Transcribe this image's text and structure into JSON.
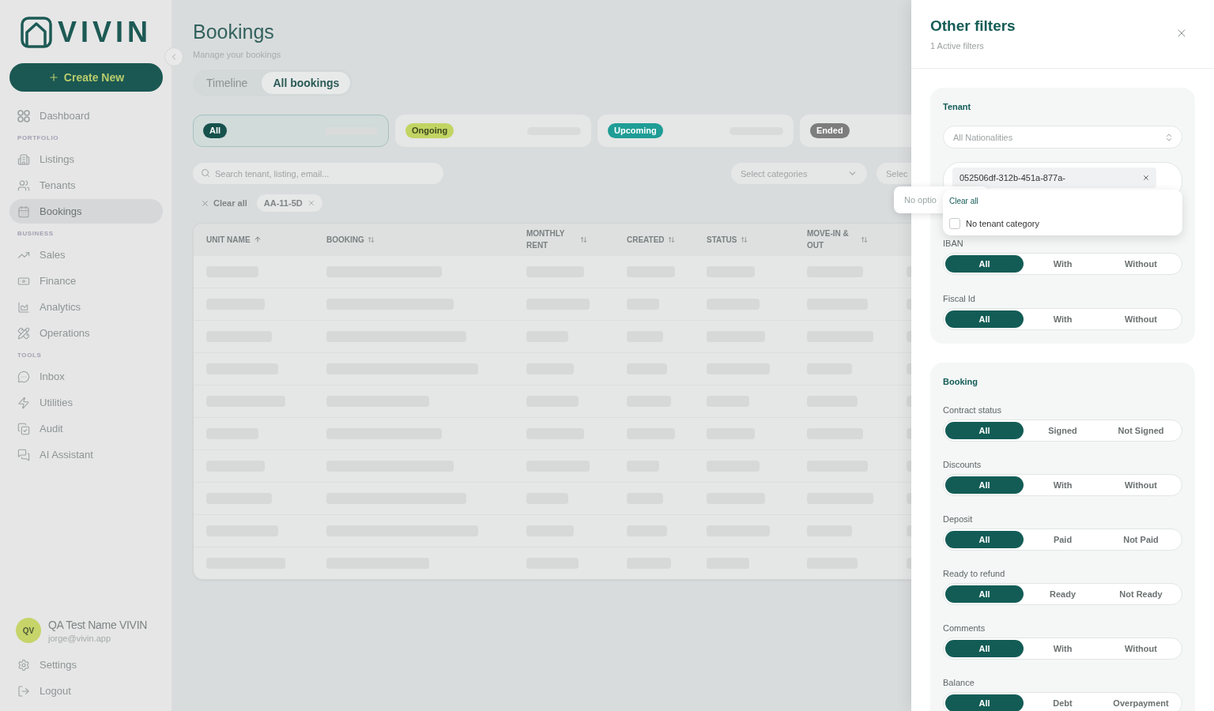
{
  "sidebar": {
    "logo": "VIVIN",
    "create_button": "Create New",
    "nav_groups": [
      {
        "items": [
          {
            "label": "Dashboard",
            "selected": false
          }
        ]
      },
      {
        "heading": "PORTFOLIO",
        "items": [
          {
            "label": "Listings",
            "selected": false
          },
          {
            "label": "Tenants",
            "selected": false
          },
          {
            "label": "Bookings",
            "selected": true
          }
        ]
      },
      {
        "heading": "BUSINESS",
        "items": [
          {
            "label": "Sales",
            "selected": false
          },
          {
            "label": "Finance",
            "selected": false
          },
          {
            "label": "Analytics",
            "selected": false
          },
          {
            "label": "Operations",
            "selected": false
          }
        ]
      },
      {
        "heading": "TOOLS",
        "items": [
          {
            "label": "Inbox",
            "selected": false
          },
          {
            "label": "Utilities",
            "selected": false
          },
          {
            "label": "Audit",
            "selected": false
          },
          {
            "label": "AI Assistant",
            "selected": false
          }
        ]
      }
    ],
    "user": {
      "initials": "QV",
      "name": "QA Test Name VIVIN",
      "email": "jorge@vivin.app"
    },
    "footer_items": [
      "Settings",
      "Logout"
    ]
  },
  "page": {
    "title": "Bookings",
    "subtitle": "Manage your bookings",
    "view_tabs": [
      {
        "label": "Timeline",
        "selected": false
      },
      {
        "label": "All bookings",
        "selected": true
      }
    ],
    "status_cards": {
      "loading": true,
      "items": [
        {
          "label": "All",
          "selected": true,
          "color": "#17514d"
        },
        {
          "label": "Ongoing",
          "selected": false,
          "color": "#c2d463"
        },
        {
          "label": "Upcoming",
          "selected": false,
          "color": "#1f9d96"
        },
        {
          "label": "Ended",
          "selected": false,
          "color": "#7d7d7d"
        }
      ]
    },
    "search": {
      "placeholder": "Search tenant, listing, email..."
    },
    "selects": [
      {
        "placeholder": "Select categories"
      },
      {
        "placeholder": "Selec"
      }
    ],
    "select_popup": {
      "text": "No optio"
    },
    "active_filters": {
      "clear_label": "Clear all",
      "chips": [
        "AA-11-5D"
      ]
    },
    "table": {
      "columns": [
        {
          "label": "UNIT NAME",
          "sorted": true
        },
        {
          "label": "BOOKING",
          "sorted": false
        },
        {
          "label": "MONTHLY RENT",
          "sorted": false
        },
        {
          "label": "CREATED",
          "sorted": false
        },
        {
          "label": "STATUS",
          "sorted": false
        },
        {
          "label": "MOVE-IN & OUT",
          "sorted": false
        }
      ],
      "loading": true
    }
  },
  "filters_panel": {
    "title": "Other filters",
    "subtitle": "1 Active filters",
    "sections": [
      {
        "title": "Tenant",
        "nationality_select": {
          "placeholder": "All Nationalities"
        },
        "multi_select": {
          "chips": [
            "052506df-312b-451a-877a-"
          ],
          "menu": {
            "clear_label": "Clear all",
            "options": [
              {
                "label": "No tenant category",
                "checked": false
              }
            ]
          }
        },
        "groups": [
          {
            "label": "IBAN",
            "options": [
              {
                "label": "All",
                "selected": true
              },
              {
                "label": "With",
                "selected": false
              },
              {
                "label": "Without",
                "selected": false
              }
            ]
          },
          {
            "label": "Fiscal Id",
            "options": [
              {
                "label": "All",
                "selected": true
              },
              {
                "label": "With",
                "selected": false
              },
              {
                "label": "Without",
                "selected": false
              }
            ]
          }
        ]
      },
      {
        "title": "Booking",
        "groups": [
          {
            "label": "Contract status",
            "options": [
              {
                "label": "All",
                "selected": true
              },
              {
                "label": "Signed",
                "selected": false
              },
              {
                "label": "Not Signed",
                "selected": false
              }
            ]
          },
          {
            "label": "Discounts",
            "options": [
              {
                "label": "All",
                "selected": true
              },
              {
                "label": "With",
                "selected": false
              },
              {
                "label": "Without",
                "selected": false
              }
            ]
          },
          {
            "label": "Deposit",
            "options": [
              {
                "label": "All",
                "selected": true
              },
              {
                "label": "Paid",
                "selected": false
              },
              {
                "label": "Not Paid",
                "selected": false
              }
            ]
          },
          {
            "label": "Ready to refund",
            "options": [
              {
                "label": "All",
                "selected": true
              },
              {
                "label": "Ready",
                "selected": false
              },
              {
                "label": "Not Ready",
                "selected": false
              }
            ]
          },
          {
            "label": "Comments",
            "options": [
              {
                "label": "All",
                "selected": true
              },
              {
                "label": "With",
                "selected": false
              },
              {
                "label": "Without",
                "selected": false
              }
            ]
          },
          {
            "label": "Balance",
            "options": [
              {
                "label": "All",
                "selected": true
              },
              {
                "label": "Debt",
                "selected": false
              },
              {
                "label": "Overpayment",
                "selected": false
              }
            ]
          }
        ]
      }
    ]
  }
}
